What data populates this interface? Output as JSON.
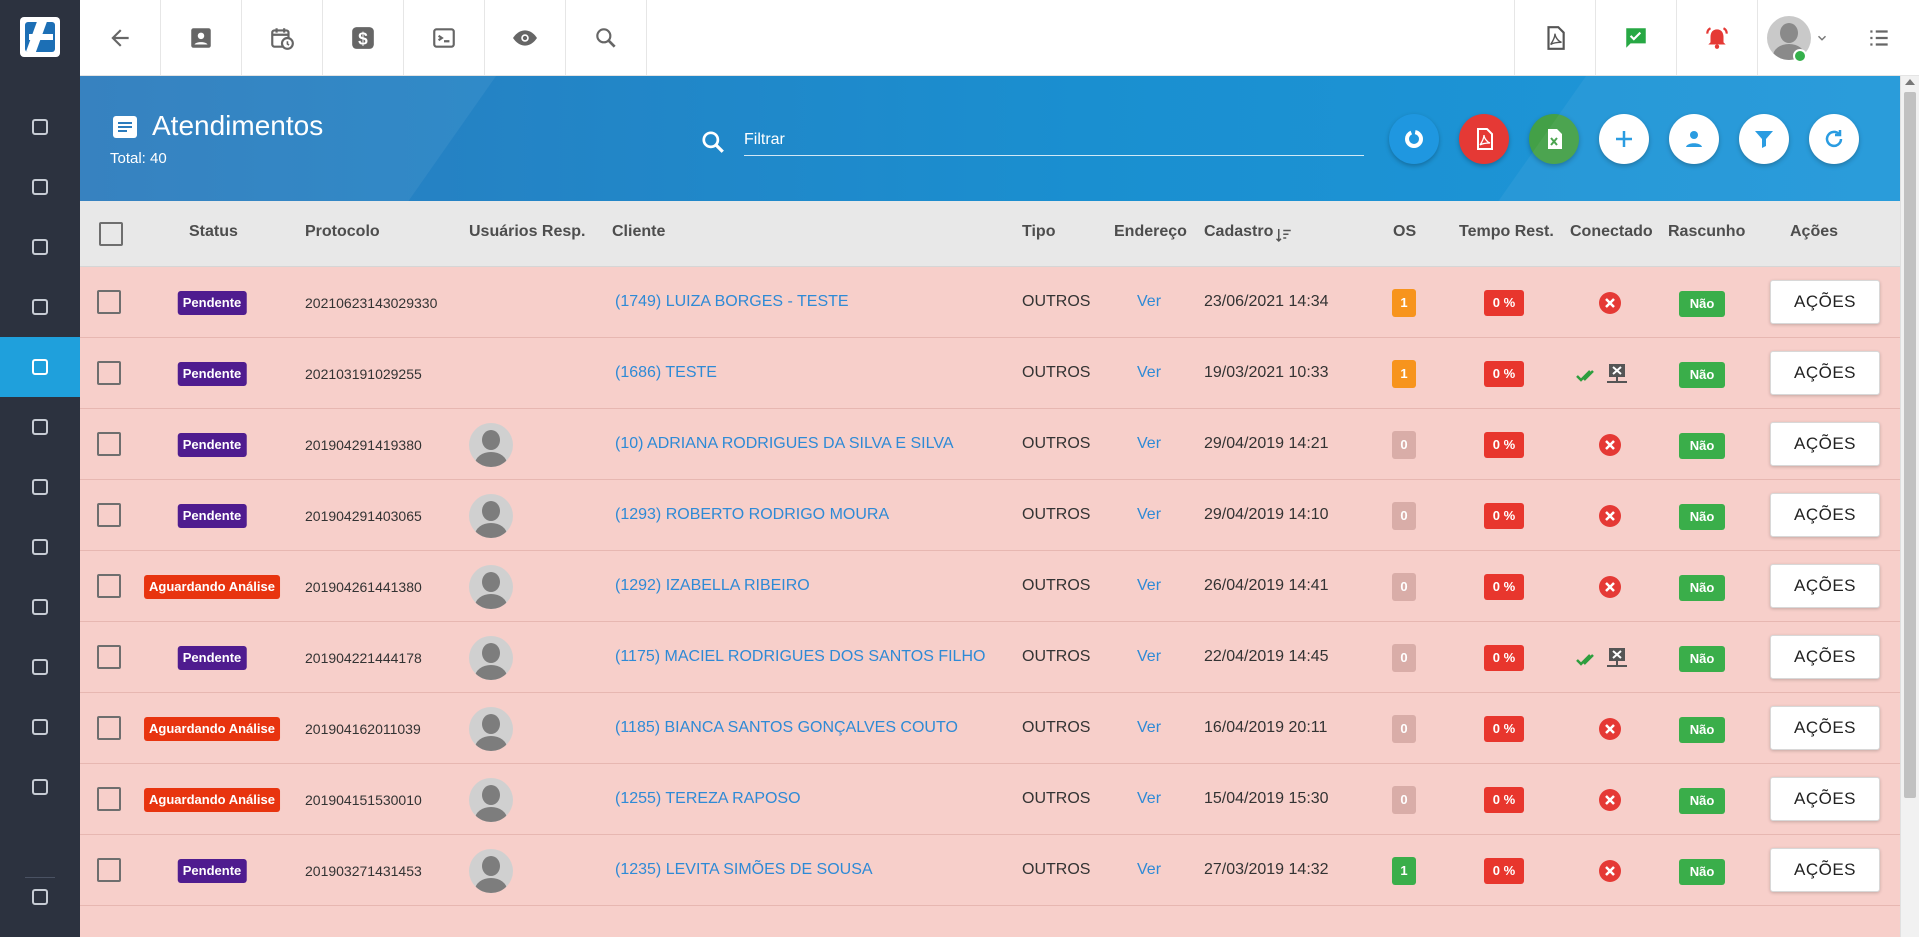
{
  "colors": {
    "sidebar": "#2c323f",
    "accent": "#1fa0dc",
    "header_blue": "#1a8fd0",
    "row_bg": "#f7cfca",
    "status_pendente": "#4f1c8f",
    "status_aguardando": "#e8340f",
    "link": "#2e8ad6",
    "os_orange": "#f7941d",
    "os_gray": "#d9ada8",
    "os_green": "#3aae4a",
    "tempo_red": "#e8362d",
    "nao_green": "#3aae4a"
  },
  "sidebar": {
    "items": [
      {
        "icon": "dashboard-icon"
      },
      {
        "icon": "pie-chart-icon"
      },
      {
        "icon": "contacts-icon"
      },
      {
        "icon": "kanban-icon"
      },
      {
        "icon": "calendar-clock-icon",
        "active": true
      },
      {
        "icon": "box-icon"
      },
      {
        "icon": "money-icon"
      },
      {
        "icon": "map-pin-icon"
      },
      {
        "icon": "list-icon"
      },
      {
        "icon": "dns-icon"
      },
      {
        "icon": "document-icon"
      },
      {
        "icon": "gear-icon"
      },
      {
        "icon": "youtube-icon"
      }
    ]
  },
  "topbar": {
    "left_icons": [
      "back-arrow-icon",
      "contacts-icon",
      "calendar-clock-icon",
      "dollar-icon",
      "terminal-icon",
      "eye-icon",
      "search-icon"
    ],
    "right_icons": [
      "pdf-icon",
      "check-message-icon",
      "alarm-bell-icon",
      "user-avatar",
      "list-menu-icon"
    ]
  },
  "header": {
    "title": "Atendimentos",
    "total": "Total: 40",
    "search_placeholder": "Filtrar",
    "buttons": [
      {
        "icon": "chart-donut-icon",
        "color": "#1f97e0"
      },
      {
        "icon": "pdf-icon",
        "color": "#e53935"
      },
      {
        "icon": "excel-icon",
        "color": "#43a047"
      },
      {
        "icon": "plus-icon",
        "color": "#ffffff"
      },
      {
        "icon": "user-icon",
        "color": "#ffffff"
      },
      {
        "icon": "filter-icon",
        "color": "#ffffff"
      },
      {
        "icon": "refresh-icon",
        "color": "#ffffff"
      }
    ]
  },
  "table": {
    "columns": {
      "status": "Status",
      "protocolo": "Protocolo",
      "usuarios": "Usuários Resp.",
      "cliente": "Cliente",
      "tipo": "Tipo",
      "endereco": "Endereço",
      "cadastro": "Cadastro",
      "os": "OS",
      "tempo": "Tempo Rest.",
      "conectado": "Conectado",
      "rascunho": "Rascunho",
      "acoes": "Ações"
    },
    "rows": [
      {
        "status": "Pendente",
        "protocolo": "20210623143029330",
        "avatar": false,
        "cliente": "(1749) LUIZA BORGES - TESTE",
        "tipo": "OUTROS",
        "endereco": "Ver",
        "cadastro": "23/06/2021 14:34",
        "os": "1",
        "os_color": "#f7941d",
        "tempo": "0 %",
        "conectado": "no",
        "rascunho": "Não",
        "acoes": "AÇÕES"
      },
      {
        "status": "Pendente",
        "protocolo": "202103191029255",
        "avatar": false,
        "cliente": "(1686) TESTE",
        "tipo": "OUTROS",
        "endereco": "Ver",
        "cadastro": "19/03/2021 10:33",
        "os": "1",
        "os_color": "#f7941d",
        "tempo": "0 %",
        "conectado": "partial",
        "rascunho": "Não",
        "acoes": "AÇÕES"
      },
      {
        "status": "Pendente",
        "protocolo": "201904291419380",
        "avatar": true,
        "cliente": "(10) ADRIANA RODRIGUES DA SILVA E SILVA",
        "tipo": "OUTROS",
        "endereco": "Ver",
        "cadastro": "29/04/2019 14:21",
        "os": "0",
        "os_color": "#d9ada8",
        "tempo": "0 %",
        "conectado": "no",
        "rascunho": "Não",
        "acoes": "AÇÕES"
      },
      {
        "status": "Pendente",
        "protocolo": "201904291403065",
        "avatar": true,
        "cliente": "(1293) ROBERTO RODRIGO MOURA",
        "tipo": "OUTROS",
        "endereco": "Ver",
        "cadastro": "29/04/2019 14:10",
        "os": "0",
        "os_color": "#d9ada8",
        "tempo": "0 %",
        "conectado": "no",
        "rascunho": "Não",
        "acoes": "AÇÕES"
      },
      {
        "status": "Aguardando Análise",
        "protocolo": "201904261441380",
        "avatar": true,
        "cliente": "(1292) IZABELLA RIBEIRO",
        "tipo": "OUTROS",
        "endereco": "Ver",
        "cadastro": "26/04/2019 14:41",
        "os": "0",
        "os_color": "#d9ada8",
        "tempo": "0 %",
        "conectado": "no",
        "rascunho": "Não",
        "acoes": "AÇÕES"
      },
      {
        "status": "Pendente",
        "protocolo": "201904221444178",
        "avatar": true,
        "cliente": "(1175) MACIEL RODRIGUES DOS SANTOS FILHO",
        "tipo": "OUTROS",
        "endereco": "Ver",
        "cadastro": "22/04/2019 14:45",
        "os": "0",
        "os_color": "#d9ada8",
        "tempo": "0 %",
        "conectado": "partial",
        "rascunho": "Não",
        "acoes": "AÇÕES"
      },
      {
        "status": "Aguardando Análise",
        "protocolo": "201904162011039",
        "avatar": true,
        "cliente": "(1185) BIANCA SANTOS GONÇALVES COUTO",
        "tipo": "OUTROS",
        "endereco": "Ver",
        "cadastro": "16/04/2019 20:11",
        "os": "0",
        "os_color": "#d9ada8",
        "tempo": "0 %",
        "conectado": "no",
        "rascunho": "Não",
        "acoes": "AÇÕES"
      },
      {
        "status": "Aguardando Análise",
        "protocolo": "201904151530010",
        "avatar": true,
        "cliente": "(1255) TEREZA RAPOSO",
        "tipo": "OUTROS",
        "endereco": "Ver",
        "cadastro": "15/04/2019 15:30",
        "os": "0",
        "os_color": "#d9ada8",
        "tempo": "0 %",
        "conectado": "no",
        "rascunho": "Não",
        "acoes": "AÇÕES"
      },
      {
        "status": "Pendente",
        "protocolo": "201903271431453",
        "avatar": true,
        "cliente": "(1235) LEVITA SIMÕES DE SOUSA",
        "tipo": "OUTROS",
        "endereco": "Ver",
        "cadastro": "27/03/2019 14:32",
        "os": "1",
        "os_color": "#3aae4a",
        "tempo": "0 %",
        "conectado": "no",
        "rascunho": "Não",
        "acoes": "AÇÕES"
      }
    ]
  }
}
